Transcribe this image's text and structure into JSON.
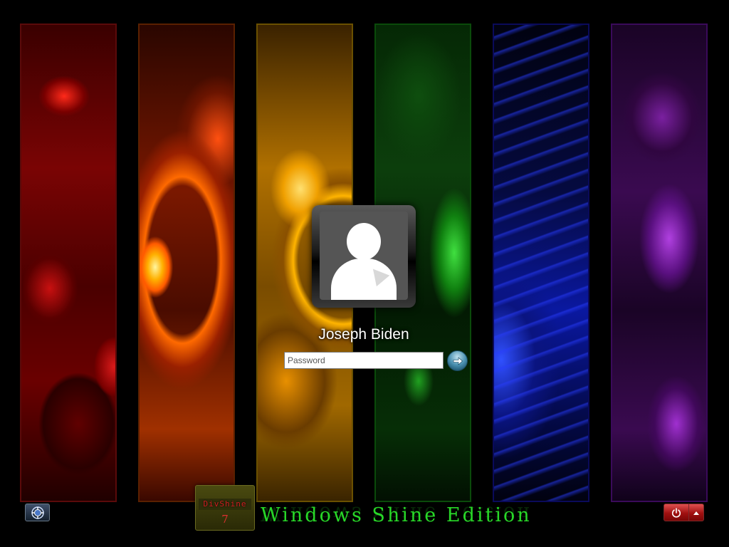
{
  "wallpaper": {
    "panels": [
      "red",
      "orange",
      "yellow",
      "green",
      "blue",
      "purple"
    ]
  },
  "login": {
    "user_icon": "user-silhouette-icon",
    "username": "Joseph Biden",
    "password_placeholder": "Password",
    "password_value": "",
    "submit_icon": "arrow-right-icon"
  },
  "taskbar": {
    "ease_of_access_icon": "ease-of-access-icon",
    "power_icon": "power-icon",
    "power_options_icon": "chevron-up-icon"
  },
  "branding": {
    "name": "DivShine",
    "version": "7",
    "edition": "Windows Shine Edition"
  },
  "colors": {
    "edition_text": "#28d828",
    "power_button": "#a01010",
    "brand_text": "#d02020"
  }
}
